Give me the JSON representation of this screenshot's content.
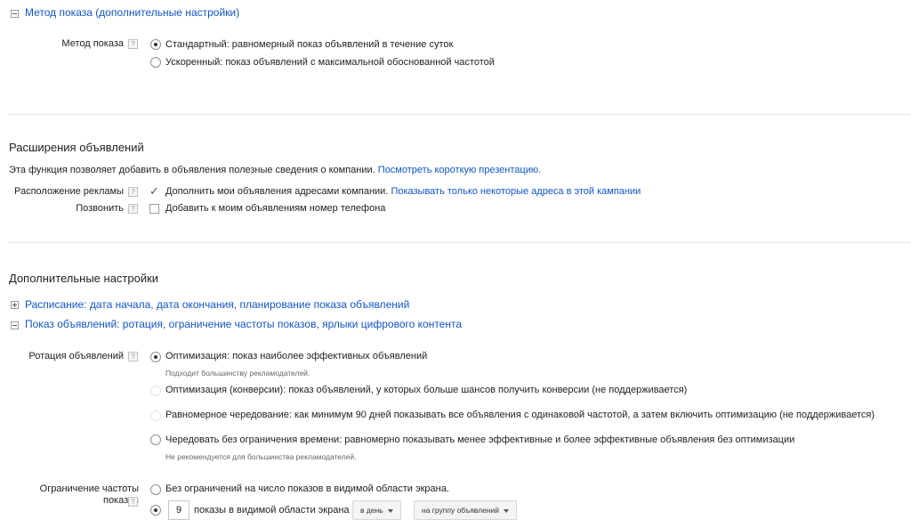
{
  "delivery": {
    "toggle_title": "Метод показа (дополнительные настройки)",
    "label": "Метод показа",
    "options": [
      "Стандартный: равномерный показ объявлений в течение суток",
      "Ускоренный: показ объявлений с максимальной обоснованной частотой"
    ],
    "selected_index": 0
  },
  "extensions": {
    "heading": "Расширения объявлений",
    "description": "Эта функция позволяет добавить в объявления полезные сведения о компании.",
    "presentation_link": "Посмотреть короткую презентацию.",
    "location_label": "Расположение рекламы",
    "location_text": "Дополнить мои объявления адресами компании.",
    "location_link": "Показывать только некоторые адреса в этой кампании",
    "location_checked": true,
    "call_label": "Позвонить",
    "call_text": "Добавить к моим объявлениям номер телефона",
    "call_checked": false
  },
  "advanced": {
    "heading": "Дополнительные настройки",
    "schedule_link": "Расписание: дата начала, дата окончания, планирование показа объявлений",
    "ad_delivery_link": "Показ объявлений: ротация, ограничение частоты показов, ярлыки цифрового контента",
    "rotation": {
      "label": "Ротация объявлений",
      "options": [
        {
          "text": "Оптимизация: показ наиболее эффективных объявлений",
          "hint": "Подходит большинству рекламодателей."
        },
        {
          "text": "Оптимизация (конверсии): показ объявлений, у которых больше шансов получить конверсии (не поддерживается)",
          "hint": ""
        },
        {
          "text": "Равномерное чередование: как минимум 90 дней показывать все объявления с одинаковой частотой, а затем включить оптимизацию (не поддерживается)",
          "hint": ""
        },
        {
          "text": "Чередовать без ограничения времени: равномерно показывать менее эффективные и более эффективные объявления без оптимизации",
          "hint": "Не рекомендуется для большинства рекламодателей."
        }
      ],
      "selected_index": 0
    },
    "frequency": {
      "label_line1": "Ограничение частоты",
      "label_line2": "показов",
      "option_unlimited": "Без ограничений на число показов в видимой области экрана.",
      "cap_value": "9",
      "cap_text": "показы в видимой области экрана",
      "period_select": "в день",
      "level_select": "на группу объявлений",
      "selected_index": 1
    }
  },
  "help_glyph": "?"
}
